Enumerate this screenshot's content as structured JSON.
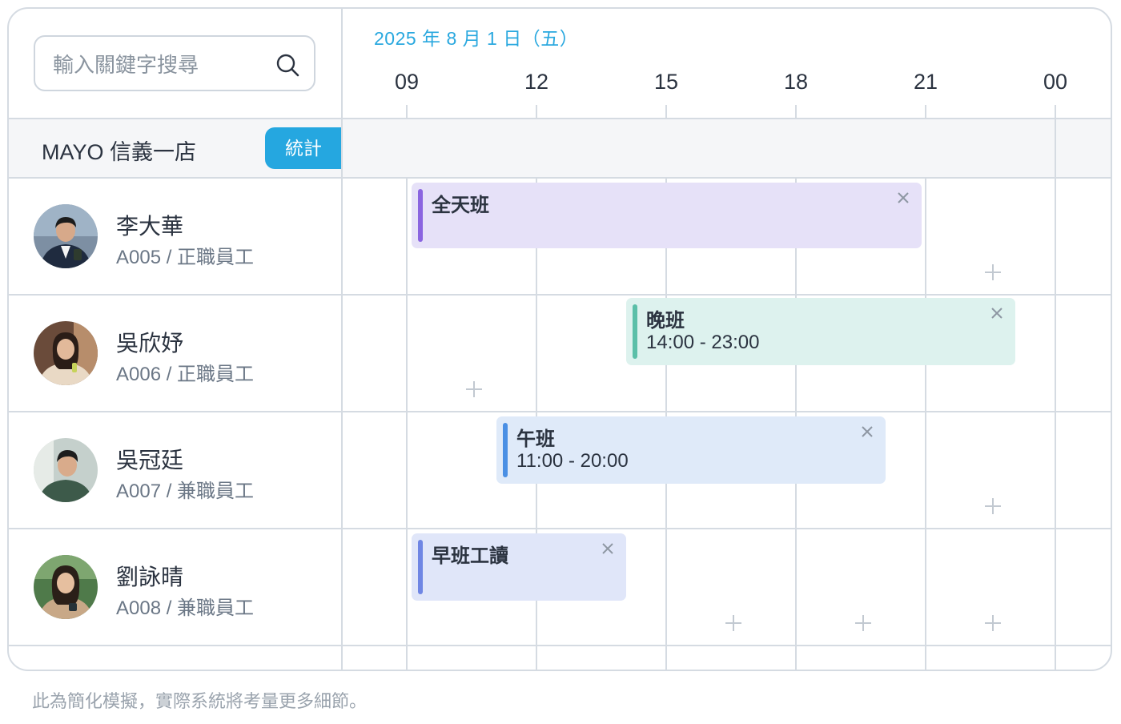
{
  "search": {
    "placeholder": "輸入關鍵字搜尋"
  },
  "timeline": {
    "date": "2025 年 8 月 1 日（五）",
    "hours": [
      "09",
      "12",
      "15",
      "18",
      "21",
      "00"
    ]
  },
  "store": {
    "name": "MAYO 信義一店",
    "stats_label": "統計"
  },
  "employees": [
    {
      "name": "李大華",
      "sub": "A005 / 正職員工"
    },
    {
      "name": "吳欣妤",
      "sub": "A006 / 正職員工"
    },
    {
      "name": "吳冠廷",
      "sub": "A007 / 兼職員工"
    },
    {
      "name": "劉詠晴",
      "sub": "A008 / 兼職員工"
    }
  ],
  "shifts": [
    {
      "title": "全天班",
      "time": "",
      "color": "#e6e1f8",
      "accent": "#8a64e0"
    },
    {
      "title": "晚班",
      "time": "14:00 - 23:00",
      "color": "#ddf2ee",
      "accent": "#5bbfa8"
    },
    {
      "title": "午班",
      "time": "11:00 - 20:00",
      "color": "#dfeaf9",
      "accent": "#4a8fe4"
    },
    {
      "title": "早班工讀",
      "time": "",
      "color": "#e0e6f9",
      "accent": "#6f86e4"
    }
  ],
  "footer": {
    "note": "此為簡化模擬，實際系統將考量更多細節。"
  },
  "icons": {
    "search": "search-icon",
    "close": "close-icon",
    "add": "plus-icon"
  }
}
